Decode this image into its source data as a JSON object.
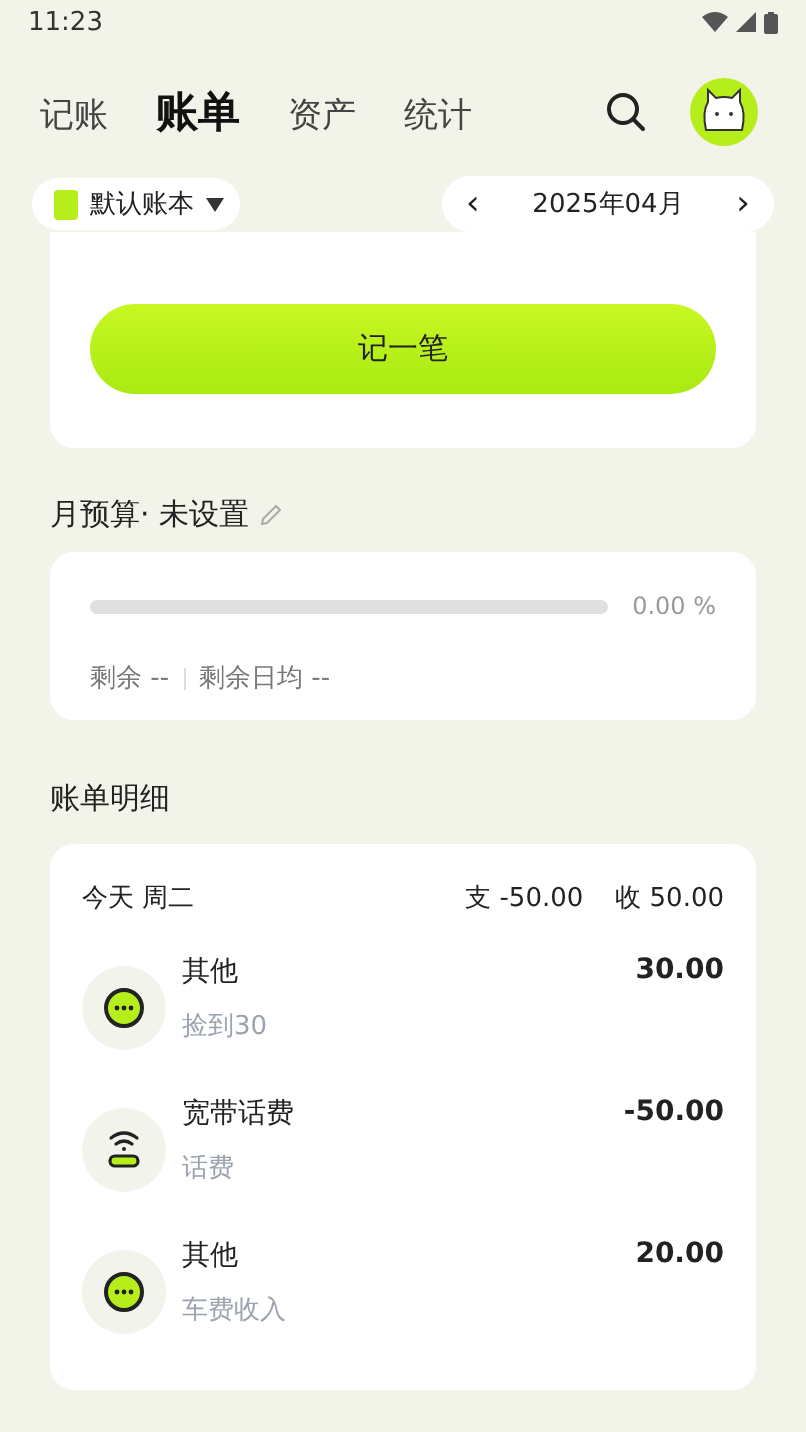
{
  "status_bar": {
    "time": "11:23"
  },
  "tabs": [
    {
      "label": "记账",
      "selected": false
    },
    {
      "label": "账单",
      "selected": true
    },
    {
      "label": "资产",
      "selected": false
    },
    {
      "label": "统计",
      "selected": false
    }
  ],
  "book_selector": {
    "label": "默认账本"
  },
  "month_picker": {
    "prev": "‹",
    "value": "2025年04月",
    "next": "›"
  },
  "record_button": "记一笔",
  "budget": {
    "title": "月预算· 未设置",
    "level": 0,
    "percent": "0.00 %",
    "remaining": "剩余 --",
    "daily_remaining": "剩余日均 --"
  },
  "details": {
    "title": "账单明细",
    "day": "今天 周二",
    "expense": "支 -50.00",
    "income": "收 50.00",
    "entries": [
      {
        "kind": "other",
        "category": "其他",
        "note": "捡到30",
        "amount": "30.00"
      },
      {
        "kind": "router",
        "category": "宽带话费",
        "note": "话费",
        "amount": "-50.00"
      },
      {
        "kind": "other",
        "category": "其他",
        "note": "车费收入",
        "amount": "20.00"
      }
    ]
  }
}
